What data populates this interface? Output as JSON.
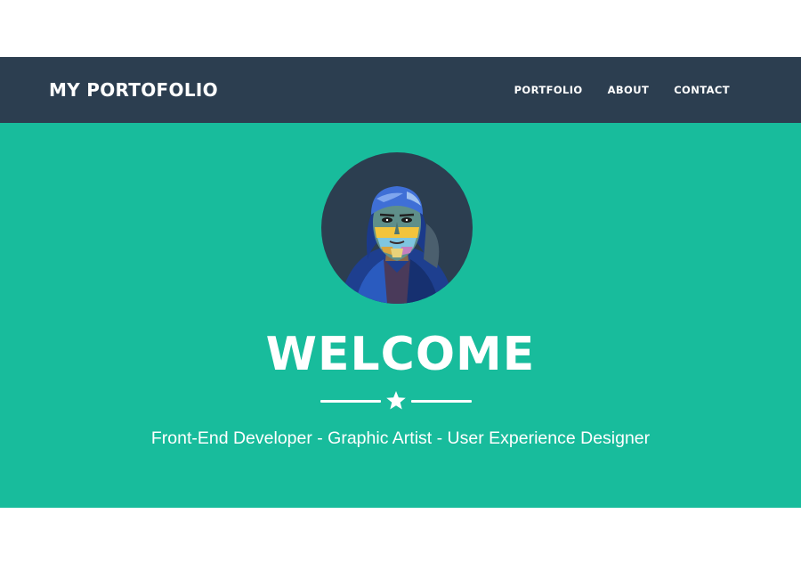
{
  "navbar": {
    "brand": "MY PORTOFOLIO",
    "links": [
      {
        "label": "PORTFOLIO"
      },
      {
        "label": "ABOUT"
      },
      {
        "label": "CONTACT"
      }
    ]
  },
  "hero": {
    "avatar_icon": "profile-portrait-icon",
    "title": "WELCOME",
    "divider_icon": "star-icon",
    "tagline": "Front-End Developer - Graphic Artist - User Experience Designer"
  },
  "colors": {
    "navbar_bg": "#2c3e50",
    "hero_bg": "#18bc9c",
    "text": "#ffffff"
  }
}
